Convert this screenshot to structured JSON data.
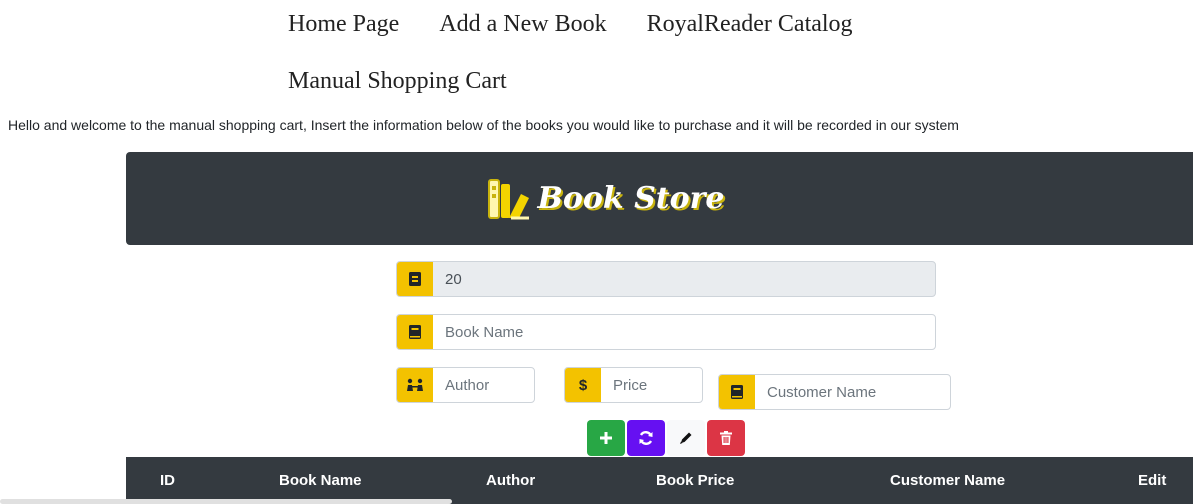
{
  "nav": {
    "home": "Home Page",
    "add_book": "Add a New Book",
    "catalog": "RoyalReader Catalog"
  },
  "page_title": "Manual Shopping Cart",
  "welcome_text": "Hello and welcome to the manual shopping cart, Insert the information below of the books you would like to purchase and it will be recorded in our system",
  "banner": {
    "title": "Book Store"
  },
  "form": {
    "id_value": "20",
    "book_name_placeholder": "Book Name",
    "author_placeholder": "Author",
    "price_placeholder": "Price",
    "customer_placeholder": "Customer Name"
  },
  "accent_color": "#f3c200",
  "table": {
    "headers": [
      "ID",
      "Book Name",
      "Author",
      "Book Price",
      "Customer Name",
      "Edit"
    ]
  }
}
